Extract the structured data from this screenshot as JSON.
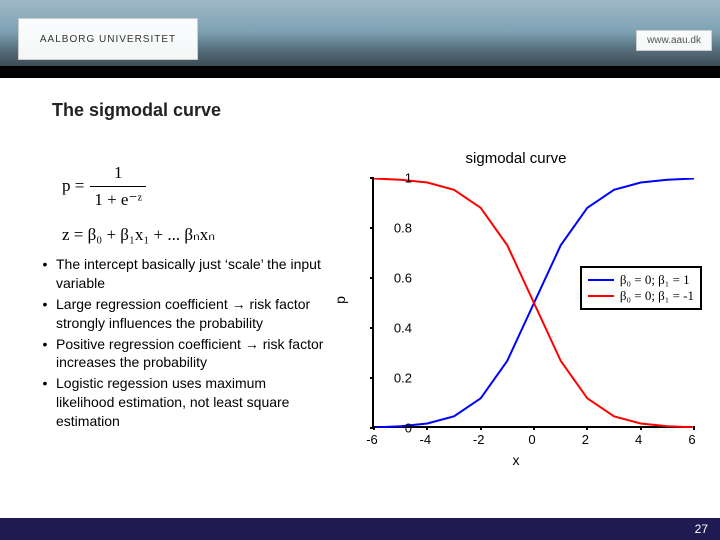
{
  "header": {
    "logo_text": "AALBORG UNIVERSITET",
    "url_text": "www.aau.dk"
  },
  "title": "The sigmodal curve",
  "formulas": {
    "p_lhs": "p =",
    "p_num": "1",
    "p_den": "1 + e⁻ᶻ",
    "z_line": "z = β₀ + β₁x₁ + ... βₙxₙ"
  },
  "bullets": [
    "The intercept basically just ‘scale’ the input variable",
    "Large regression coefficient → risk factor strongly influences the probability",
    "Positive regression coefficient → risk factor increases the probability",
    "Logistic regession uses maximum likelihood estimation, not least square estimation"
  ],
  "chart_data": {
    "type": "line",
    "title": "sigmodal curve",
    "xlabel": "x",
    "ylabel": "p",
    "xlim": [
      -6,
      6
    ],
    "ylim": [
      0,
      1
    ],
    "xticks": [
      -6,
      -4,
      -2,
      0,
      2,
      4,
      6
    ],
    "yticks": [
      0,
      0.2,
      0.4,
      0.6,
      0.8,
      1
    ],
    "series": [
      {
        "name": "β₀ = 0; β₁ = 1",
        "color": "#0000ff",
        "x": [
          -6,
          -5,
          -4,
          -3,
          -2,
          -1,
          0,
          1,
          2,
          3,
          4,
          5,
          6
        ],
        "y": [
          0.0025,
          0.0067,
          0.018,
          0.047,
          0.119,
          0.269,
          0.5,
          0.731,
          0.881,
          0.953,
          0.982,
          0.993,
          0.998
        ]
      },
      {
        "name": "β₀ = 0; β₁ = -1",
        "color": "#ff0000",
        "x": [
          -6,
          -5,
          -4,
          -3,
          -2,
          -1,
          0,
          1,
          2,
          3,
          4,
          5,
          6
        ],
        "y": [
          0.998,
          0.993,
          0.982,
          0.953,
          0.881,
          0.731,
          0.5,
          0.269,
          0.119,
          0.047,
          0.018,
          0.0067,
          0.0025
        ]
      }
    ],
    "legend_position": "right"
  },
  "footer": {
    "page_number": "27"
  }
}
